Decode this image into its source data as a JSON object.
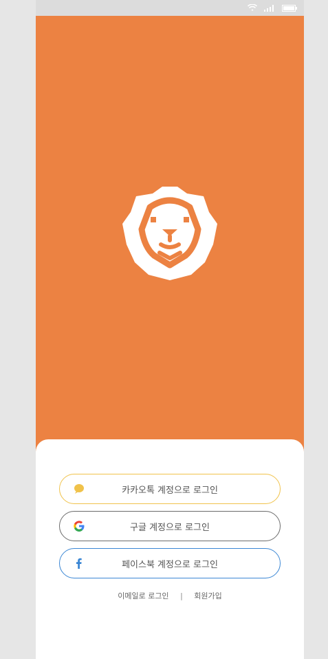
{
  "colors": {
    "brand": "#ec8242",
    "kakao": "#f0c24a",
    "google_border": "#6b6b6b",
    "facebook": "#3a86d4"
  },
  "login": {
    "kakao_label": "카카오톡 계정으로 로그인",
    "google_label": "구글 계정으로 로그인",
    "facebook_label": "페이스북 계정으로 로그인"
  },
  "footer_links": {
    "email_login": "이메일로 로그인",
    "separator": "|",
    "signup": "회원가입"
  },
  "icons": {
    "logo": "lion-logo-icon",
    "kakao": "chat-bubble-icon",
    "google": "google-g-icon",
    "facebook": "facebook-f-icon"
  }
}
